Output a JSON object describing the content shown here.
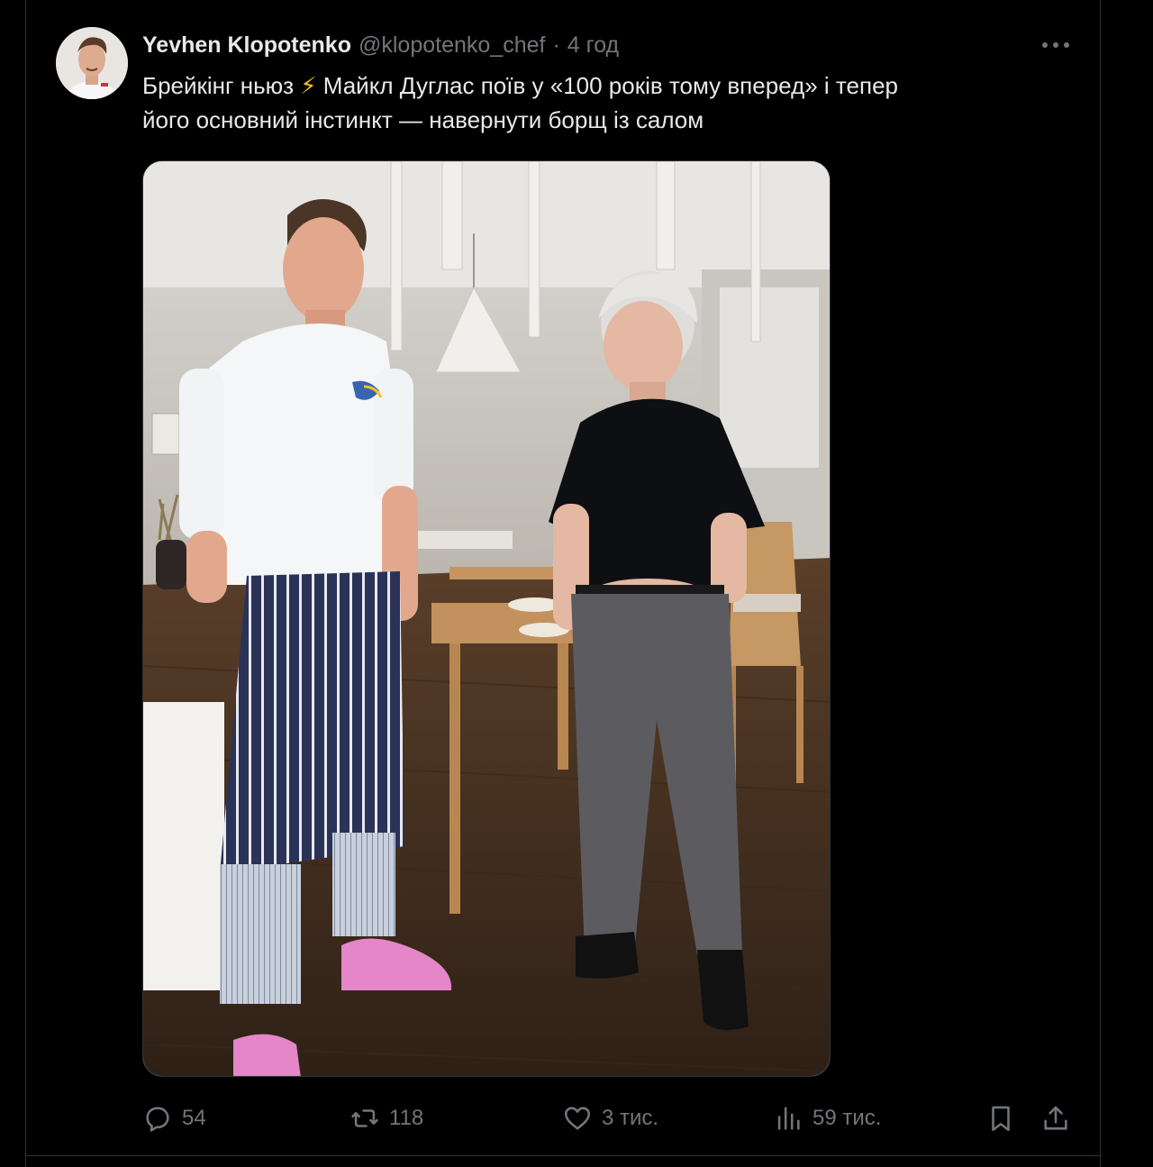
{
  "post": {
    "author_name": "Yevhen Klopotenko",
    "author_handle": "@klopotenko_chef",
    "separator": "·",
    "time": "4 год",
    "text_line1_before": "Брейкінг ньюз ",
    "bolt_emoji": "⚡",
    "text_line1_after": " Майкл Дуглас поїв у «100 років тому вперед» і тепер",
    "text_line2": "його основний інстинкт — навернути борщ із салом"
  },
  "actions": {
    "replies": "54",
    "reposts": "118",
    "likes": "3 тис.",
    "views": "59 тис."
  },
  "icons": {
    "more": "more-icon",
    "reply": "reply-icon",
    "repost": "repost-icon",
    "like": "heart-icon",
    "views": "views-icon",
    "bookmark": "bookmark-icon",
    "share": "share-icon"
  },
  "colors": {
    "background": "#000000",
    "text_primary": "#e7e9ea",
    "text_secondary": "#71767b",
    "border": "#2f3336"
  }
}
